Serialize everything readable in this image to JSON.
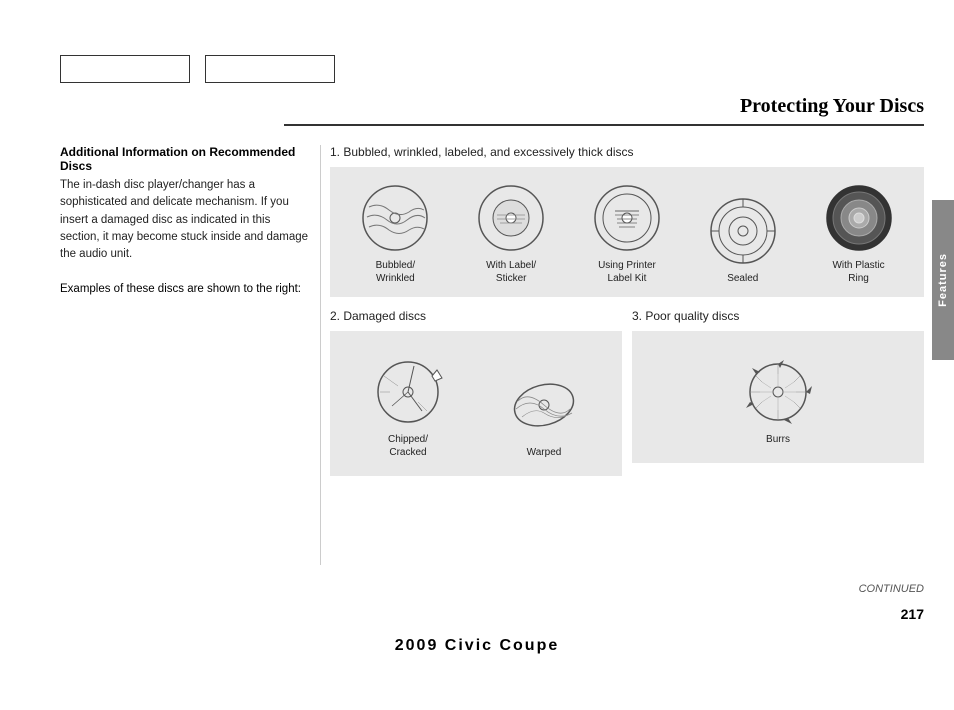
{
  "nav": {
    "btn1_label": "",
    "btn2_label": ""
  },
  "sidebar": {
    "label": "Features"
  },
  "header": {
    "title": "Protecting Your Discs"
  },
  "left": {
    "section_title": "Additional Information on Recommended Discs",
    "body": "The in-dash disc player/changer has a sophisticated and delicate mechanism. If you insert a damaged disc as indicated in this section, it may become stuck inside and damage the audio unit.",
    "examples": "Examples of these discs are shown to the right:"
  },
  "section1": {
    "label": "1. Bubbled, wrinkled, labeled, and excessively thick discs",
    "discs": [
      {
        "id": "bubbled",
        "caption": "Bubbled/\nWrinkled",
        "type": "bubbled"
      },
      {
        "id": "sticker",
        "caption": "With Label/\nSticker",
        "type": "sticker"
      },
      {
        "id": "printer",
        "caption": "Using Printer\nLabel Kit",
        "type": "printer"
      },
      {
        "id": "sealed",
        "caption": "Sealed",
        "type": "sealed"
      },
      {
        "id": "plastic-ring",
        "caption": "With Plastic\nRing",
        "type": "ring"
      }
    ]
  },
  "section2": {
    "label": "2. Damaged discs",
    "discs": [
      {
        "id": "chipped",
        "caption": "Chipped/\nCracked",
        "type": "chipped"
      },
      {
        "id": "warped",
        "caption": "Warped",
        "type": "warped"
      }
    ]
  },
  "section3": {
    "label": "3. Poor quality discs",
    "discs": [
      {
        "id": "burrs",
        "caption": "Burrs",
        "type": "burrs"
      }
    ]
  },
  "footer": {
    "continued": "CONTINUED",
    "page_number": "217",
    "title": "2009  Civic  Coupe"
  }
}
